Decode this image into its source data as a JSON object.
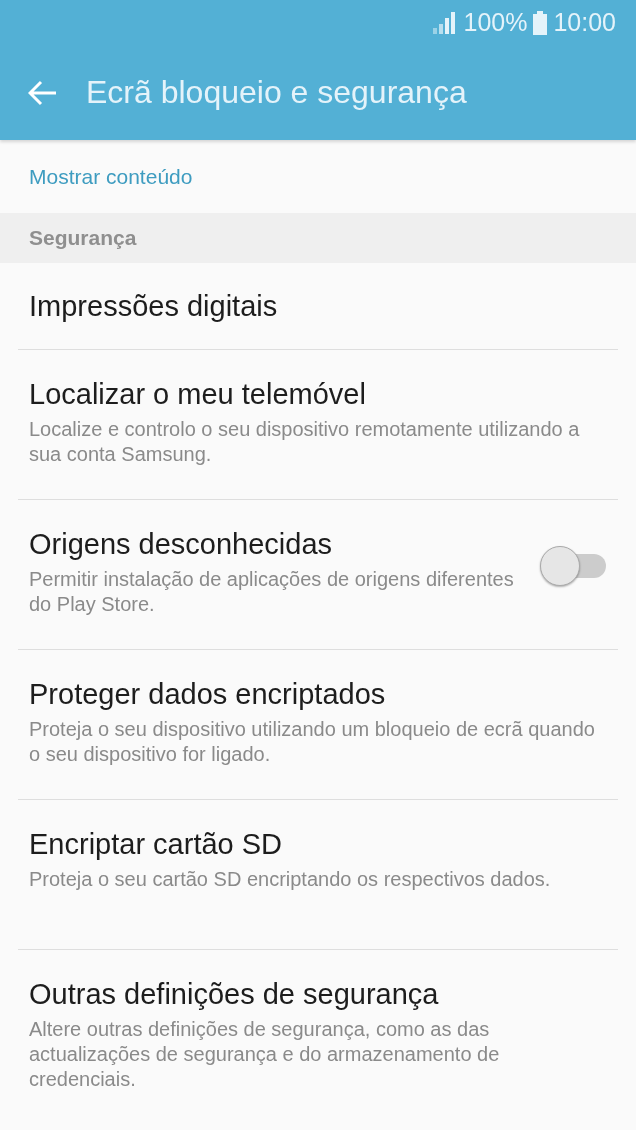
{
  "status_bar": {
    "battery": "100%",
    "time": "10:00"
  },
  "toolbar": {
    "title": "Ecrã bloqueio e segurança"
  },
  "top_item": {
    "value": "Mostrar conteúdo"
  },
  "section": {
    "header": "Segurança"
  },
  "items": [
    {
      "kind": "plain",
      "title": "Impressões digitais"
    },
    {
      "kind": "plain",
      "title": "Localizar o meu telemóvel",
      "subtitle": "Localize e controlo o seu dispositivo remotamente utilizando a sua conta Samsung."
    },
    {
      "kind": "switch",
      "title": "Origens desconhecidas",
      "subtitle": "Permitir instalação de aplicações de origens diferentes do Play Store.",
      "on": false
    },
    {
      "kind": "plain",
      "title": "Proteger dados encriptados",
      "subtitle": "Proteja o seu dispositivo utilizando um bloqueio de ecrã quando o seu dispositivo for ligado."
    },
    {
      "kind": "plain",
      "title": "Encriptar cartão SD",
      "subtitle": "Proteja o seu cartão SD encriptando os respectivos dados."
    },
    {
      "kind": "plain",
      "title": "Outras definições de segurança",
      "subtitle": "Altere outras definições de segurança, como as das actualizações de segurança e do armazenamento de credenciais."
    }
  ]
}
